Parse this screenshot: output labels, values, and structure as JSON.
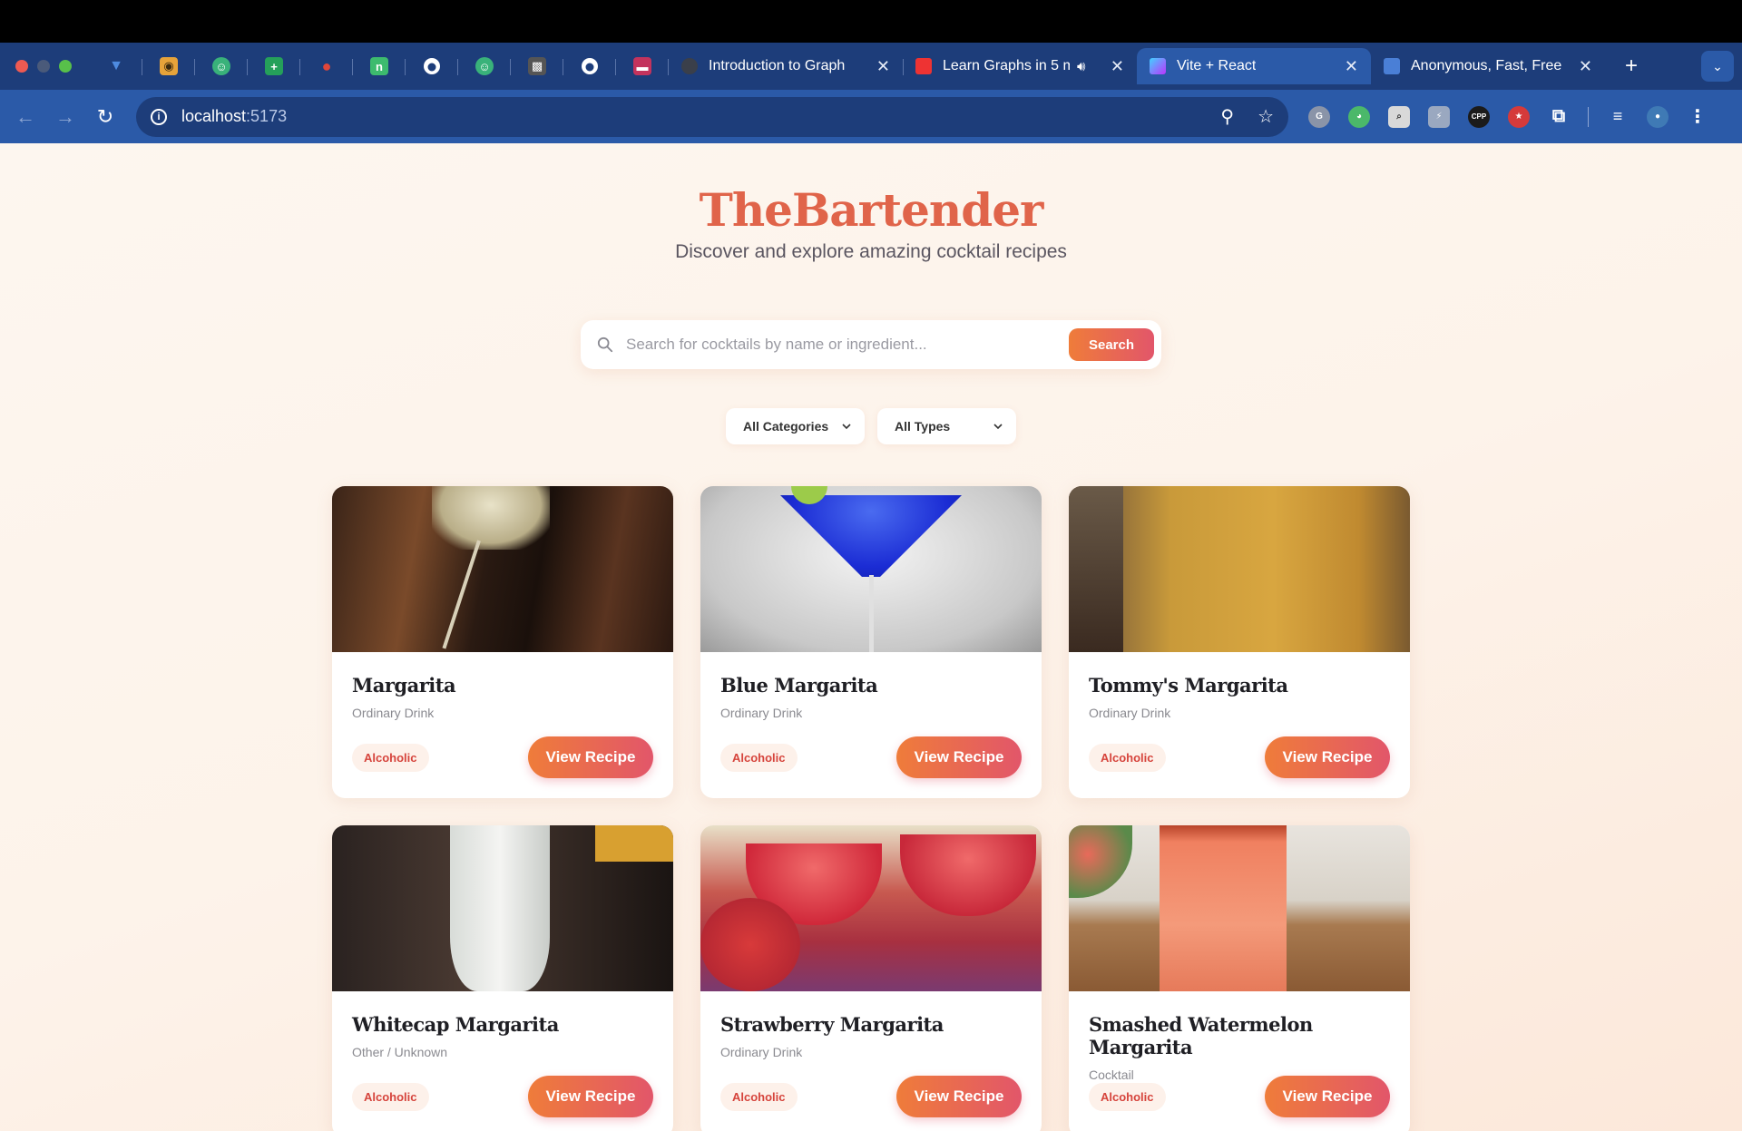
{
  "browser": {
    "tabs": [
      {
        "title": "Introduction to Graph",
        "favicon_color": "#3a3f4a"
      },
      {
        "title": "Learn Graphs in 5 m",
        "favicon_color": "#e33"
      },
      {
        "title": "Vite + React",
        "favicon_color": "#a86cf7",
        "active": true
      },
      {
        "title": "Anonymous, Fast, Free",
        "favicon_color": "#4a7fd6"
      }
    ],
    "pinned_tabs": [
      {
        "icon": "triangle-icon",
        "color": "#4e8be0",
        "glyph": "▼"
      },
      {
        "icon": "hex-icon",
        "color": "#e6a33a",
        "glyph": "◉"
      },
      {
        "icon": "chatgpt-icon",
        "color": "#39b27a",
        "glyph": "☺"
      },
      {
        "icon": "sheets-icon",
        "color": "#25a05a",
        "glyph": "+"
      },
      {
        "icon": "tomato-icon",
        "color": "#e0463a",
        "glyph": "●"
      },
      {
        "icon": "notion-icon",
        "color": "#3dbb6e",
        "glyph": "n"
      },
      {
        "icon": "github-icon",
        "color": "#1d3d7a",
        "glyph": "◯"
      },
      {
        "icon": "chatgpt-icon",
        "color": "#39b27a",
        "glyph": "☺"
      },
      {
        "icon": "pixel-icon",
        "color": "#555",
        "glyph": "▩"
      },
      {
        "icon": "github-icon",
        "color": "#1d3d7a",
        "glyph": "◯"
      },
      {
        "icon": "purple-icon",
        "color": "#c3335d",
        "glyph": "▬"
      }
    ],
    "url_host": "localhost",
    "url_port": ":5173"
  },
  "app": {
    "brand": "TheBartender",
    "tagline": "Discover and explore amazing cocktail recipes",
    "search": {
      "placeholder": "Search for cocktails by name or ingredient...",
      "button": "Search"
    },
    "filters": {
      "category": "All Categories",
      "type": "All Types"
    },
    "view_label": "View Recipe",
    "cocktails": [
      {
        "name": "Margarita",
        "category": "Ordinary Drink",
        "badge": "Alcoholic"
      },
      {
        "name": "Blue Margarita",
        "category": "Ordinary Drink",
        "badge": "Alcoholic"
      },
      {
        "name": "Tommy's Margarita",
        "category": "Ordinary Drink",
        "badge": "Alcoholic"
      },
      {
        "name": "Whitecap Margarita",
        "category": "Other / Unknown",
        "badge": "Alcoholic"
      },
      {
        "name": "Strawberry Margarita",
        "category": "Ordinary Drink",
        "badge": "Alcoholic"
      },
      {
        "name": "Smashed Watermelon Margarita",
        "category": "Cocktail",
        "badge": "Alcoholic"
      }
    ]
  },
  "colors": {
    "brand": "#e0644a",
    "accent_from": "#ef7c3a",
    "accent_to": "#e2566a",
    "browser_dark": "#1d3d7a",
    "browser_mid": "#2b5aa8"
  }
}
